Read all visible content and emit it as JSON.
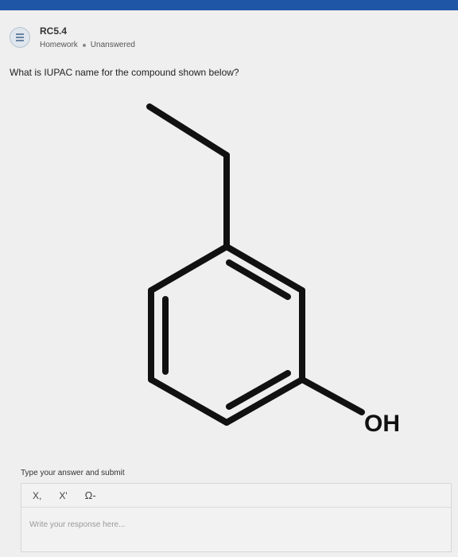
{
  "header": {
    "title": "RC5.4",
    "category": "Homework",
    "status": "Unanswered",
    "icon": "list-icon"
  },
  "question": {
    "text": "What is IUPAC name for the compound shown below?"
  },
  "molecule": {
    "substituent_label": "OH"
  },
  "answer": {
    "label": "Type your answer and submit",
    "toolbar": {
      "subscript_label": "X,",
      "superscript_label": "X'",
      "special_chars_label": "Ω-"
    },
    "placeholder": "Write your response here..."
  },
  "colors": {
    "topbar": "#1f56a6",
    "background": "#efefef"
  }
}
